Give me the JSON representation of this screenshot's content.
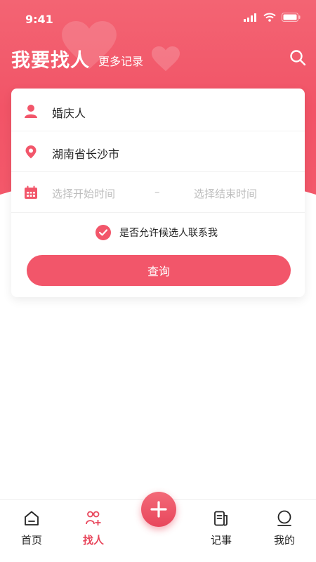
{
  "status_bar": {
    "time": "9:41"
  },
  "header": {
    "title": "我要找人",
    "more_link": "更多记录"
  },
  "form": {
    "role_value": "婚庆人",
    "location_value": "湖南省长沙市",
    "date_start_placeholder": "选择开始时间",
    "date_separator": "–",
    "date_end_placeholder": "选择结束时间",
    "consent_label": "是否允许候选人联系我",
    "consent_checked": true,
    "query_button": "查询"
  },
  "tabbar": {
    "items": [
      {
        "label": "首页",
        "icon": "home-icon"
      },
      {
        "label": "找人",
        "icon": "find-person-icon",
        "active": true
      },
      {
        "label": "",
        "icon": "plus-icon"
      },
      {
        "label": "记事",
        "icon": "notebook-icon"
      },
      {
        "label": "我的",
        "icon": "profile-icon"
      }
    ]
  },
  "colors": {
    "accent": "#f2566a",
    "active_tab": "#e8475c"
  }
}
